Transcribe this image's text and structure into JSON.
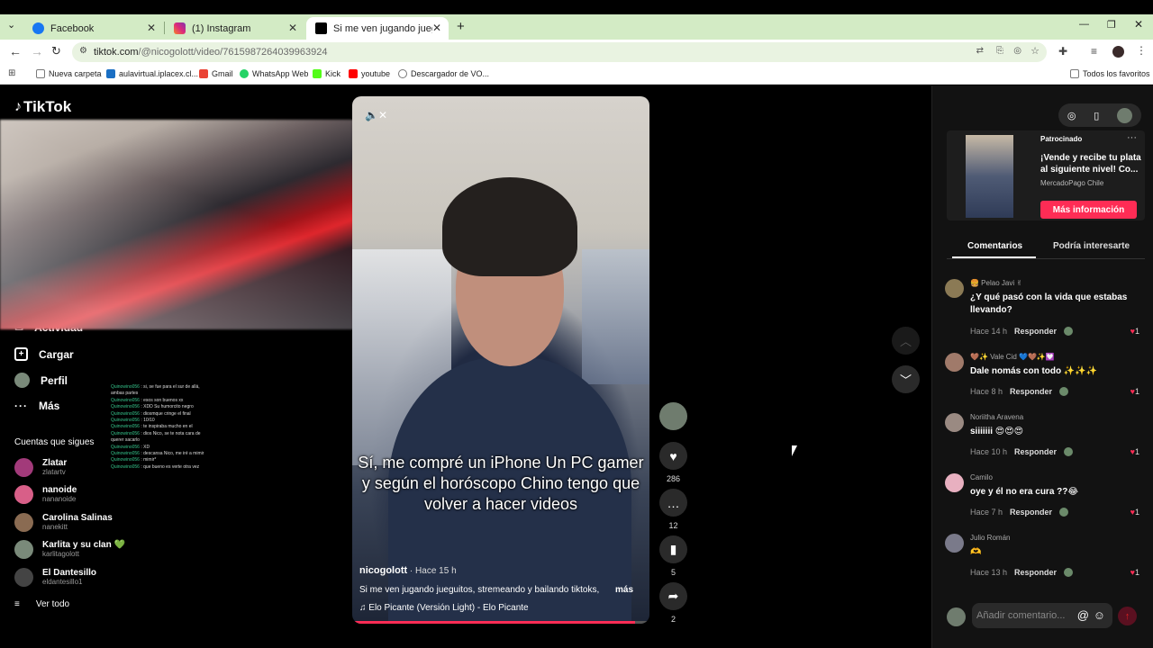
{
  "browser": {
    "tabs": [
      {
        "title": "Facebook",
        "color": "#1877f2"
      },
      {
        "title": "(1) Instagram",
        "color": "#e1306c"
      },
      {
        "title": "Si me ven jugando jueguitos, st",
        "color": "#000000"
      }
    ],
    "new_tab": "+",
    "address": {
      "host": "tiktok.com",
      "path": "/@nicogolott/video/7615987264039963924"
    },
    "bookmarks": [
      {
        "label": "Nueva carpeta",
        "color": "#7a7a7a"
      },
      {
        "label": "aulavirtual.iplacex.cl...",
        "color": "#1a6fc4"
      },
      {
        "label": "Gmail",
        "color": "#ea4335"
      },
      {
        "label": "WhatsApp Web",
        "color": "#25d366"
      },
      {
        "label": "Kick",
        "color": "#53fc18"
      },
      {
        "label": "youtube",
        "color": "#ff0000"
      },
      {
        "label": "Descargador de VO...",
        "color": "#777777"
      }
    ],
    "all_bookmarks": "Todos los favoritos"
  },
  "sidebar": {
    "logo": "TikTok",
    "items": [
      {
        "label": "Actividad",
        "icon": "activity-icon"
      },
      {
        "label": "Cargar",
        "icon": "upload-icon"
      },
      {
        "label": "Perfil",
        "icon": "profile-icon"
      },
      {
        "label": "Más",
        "icon": "more-icon"
      }
    ],
    "following_header": "Cuentas que sigues",
    "following": [
      {
        "name": "Zlatar",
        "user": "zlatartv",
        "color": "#a23a7a"
      },
      {
        "name": "nanoide",
        "user": "nananoide",
        "color": "#d85f88"
      },
      {
        "name": "Carolina Salinas",
        "user": "nanekitt",
        "color": "#8a6b52"
      },
      {
        "name": "Karlita y su clan 💚",
        "user": "karlitagolott",
        "color": "#7a8a7a"
      },
      {
        "name": "El Dantesillo",
        "user": "eldantesillo1",
        "color": "#444444"
      }
    ],
    "see_all": "Ver todo"
  },
  "chat": [
    {
      "name": "Quinowino056",
      "text": "si, se fue para el sur de allá, ambas partes"
    },
    {
      "name": "Quinowino056",
      "text": "esos son buenos xx"
    },
    {
      "name": "Quinowino056",
      "text": "XDD Su humorcito negro"
    },
    {
      "name": "Quinowino056",
      "text": "diosmque cringe el final"
    },
    {
      "name": "Quinowino056",
      "text": "10/10"
    },
    {
      "name": "Quinowino056",
      "text": "te inspiraba mucho en el"
    },
    {
      "name": "Quinowino056",
      "text": "dios Nico, se te nota cara de querer sacarlo"
    },
    {
      "name": "Quinowino056",
      "text": "XD"
    },
    {
      "name": "Quinowino056",
      "text": "descansa Nico, me iré a mimir"
    },
    {
      "name": "Quinowino056",
      "text": "mimir*"
    },
    {
      "name": "Quinowino056",
      "text": "que bueno es verte otra vez"
    }
  ],
  "video": {
    "caption": "Sí, me compré un iPhone Un PC gamer y según el horóscopo Chino tengo que volver a hacer videos",
    "author": "nicogolott",
    "time": " · Hace 15 h",
    "description": "Si me ven jugando jueguitos, stremeando y bailando tiktoks,",
    "more": "más",
    "music": "♫  Elo Picante (Versión Light) - Elo Picante",
    "progress": 0.95
  },
  "actions": {
    "likes": "286",
    "comments": "12",
    "saves": "5",
    "shares": "2"
  },
  "ad": {
    "sponsored": "Patrocinado",
    "title": "¡Vende y recibe tu plata al siguiente nivel! Co...",
    "brand": "MercadoPago Chile",
    "cta": "Más información"
  },
  "panel_tabs": [
    "Comentarios",
    "Podría interesarte"
  ],
  "comments": [
    {
      "name": "🍔 Pelao Javi ✌",
      "text": "¿Y qué pasó con la vida que estabas llevando?",
      "time": "Hace 14 h",
      "likes": "1",
      "color": "#8b7a55"
    },
    {
      "name": "🤎✨ Vale Cid 💙🤎✨💟",
      "text": "Dale nomás con todo ✨✨✨",
      "time": "Hace 8 h",
      "likes": "1",
      "color": "#a07a6a"
    },
    {
      "name": "Noriitha Aravena",
      "text": "siiiiiii 😍😍😍",
      "time": "Hace 10 h",
      "likes": "1",
      "color": "#9a8a82"
    },
    {
      "name": "Camilo",
      "text": "oye y él no era cura ??😂",
      "time": "Hace 7 h",
      "likes": "1",
      "color": "#e8b0c0"
    },
    {
      "name": "Julio Román",
      "text": "🫶",
      "time": "Hace 13 h",
      "likes": "1",
      "color": "#7a7a8a"
    }
  ],
  "reply_label": "Responder",
  "add_comment": "Añadir comentario..."
}
